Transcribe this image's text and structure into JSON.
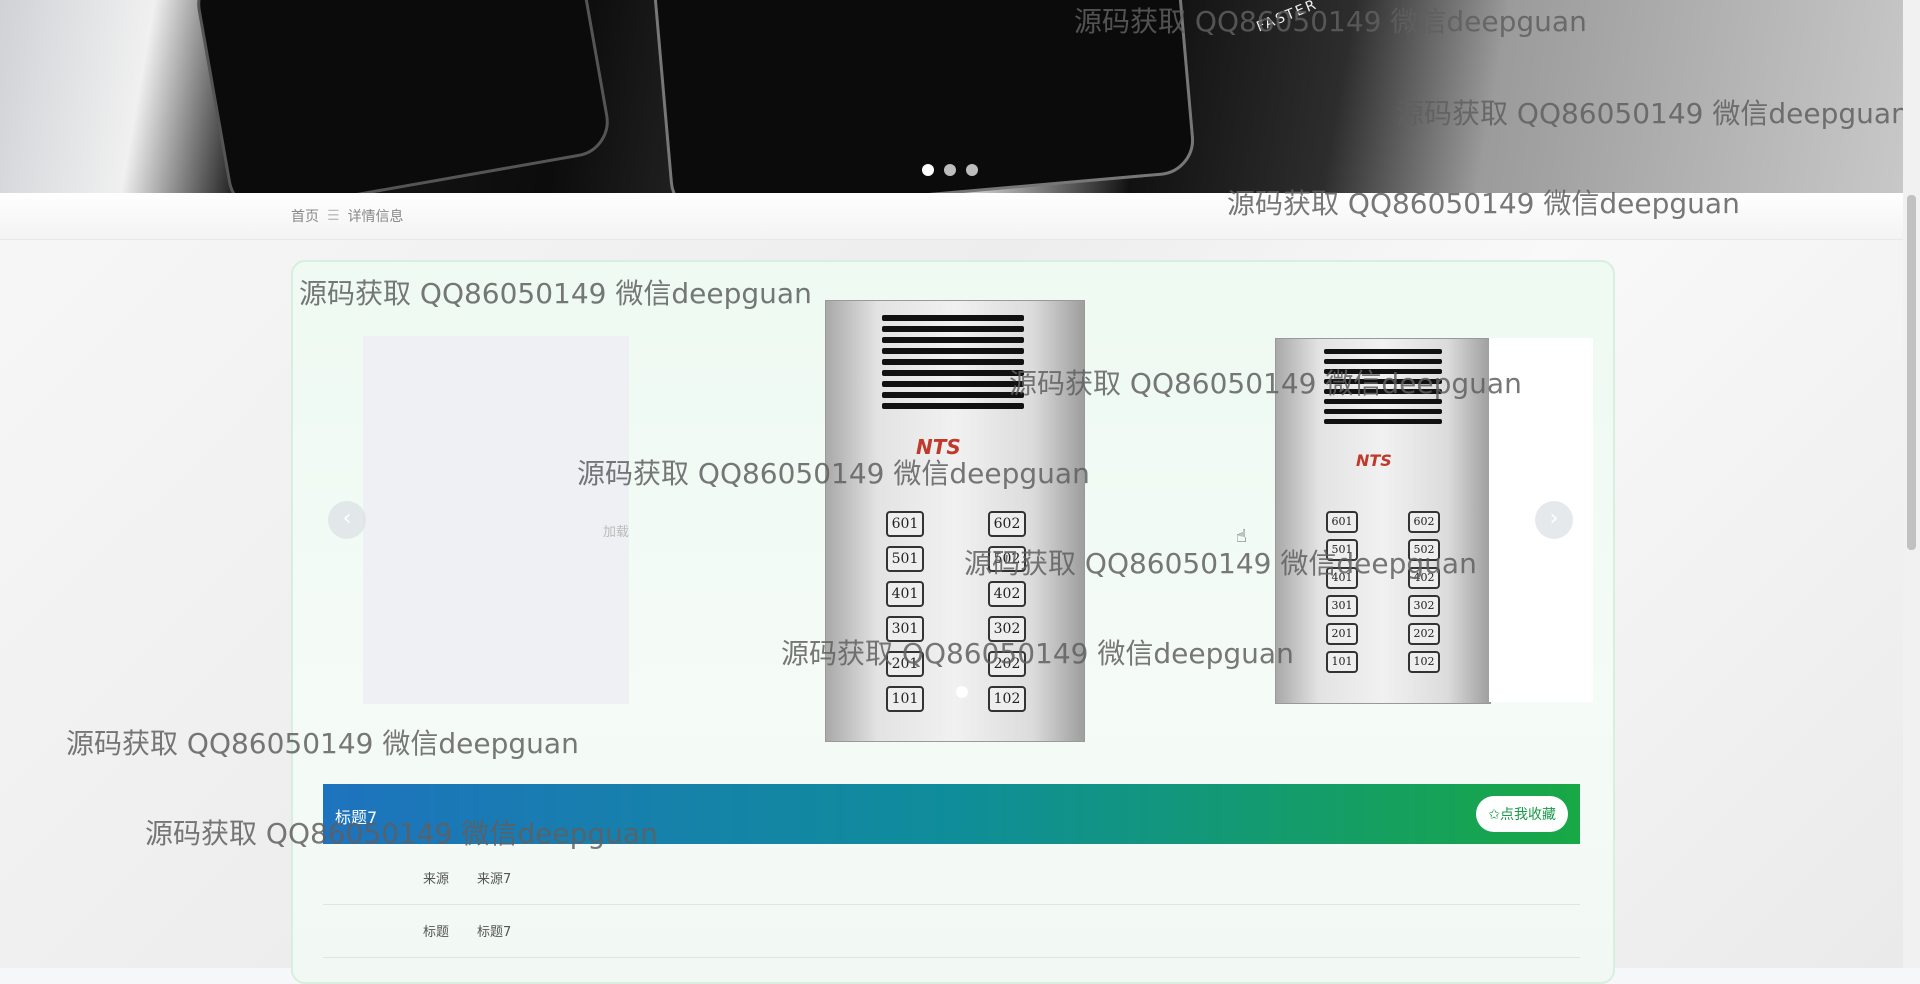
{
  "banner": {
    "brand_text": "FASTER",
    "dots": 3,
    "active_dot": 0
  },
  "breadcrumb": {
    "home": "首页",
    "separator": "☰",
    "current": "详情信息"
  },
  "carousel": {
    "loading_text": "加载",
    "prev_icon": "‹",
    "next_icon": "›",
    "intercom_logo": "NTS",
    "panel_large": [
      "601",
      "602",
      "501",
      "502",
      "401",
      "402",
      "301",
      "302",
      "201",
      "202",
      "101",
      "102"
    ],
    "panel_small": [
      "601",
      "602",
      "501",
      "502",
      "401",
      "402",
      "301",
      "302",
      "201",
      "202",
      "101",
      "102"
    ]
  },
  "detail": {
    "title": "标题7",
    "favorite_button": "✩点我收藏",
    "fields": [
      {
        "key": "来源",
        "value": "来源7"
      },
      {
        "key": "标题",
        "value": "标题7"
      }
    ]
  },
  "watermark": "源码获取 QQ86050149 微信deepguan",
  "colors": {
    "title_gradient_start": "#1e73be",
    "title_gradient_end": "#18a845",
    "accent": "#1a9a4a"
  }
}
